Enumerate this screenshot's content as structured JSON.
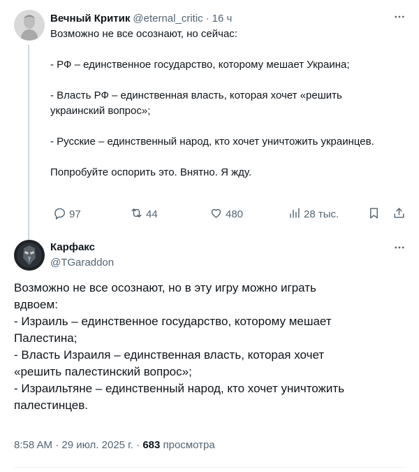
{
  "tweet1": {
    "display_name": "Вечный Критик",
    "handle": "@eternal_critic",
    "separator": "·",
    "time": "16 ч",
    "text": "Возможно не все осознают, но сейчас:\n\n- РФ – единственное государство, которому мешает Украина;\n\n- Власть РФ – единственная власть, которая хочет «решить украинский вопрос»;\n\n- Русские – единственный народ, кто хочет уничтожить украинцев.\n\nПопробуйте оспорить это. Внятно. Я жду.",
    "replies": "97",
    "retweets": "44",
    "likes": "480",
    "views": "28 тыс."
  },
  "tweet2": {
    "display_name": "Карфакс",
    "handle": "@TGaraddon",
    "text_lines": [
      "Возможно не все осознают, но в эту игру можно играть",
      "вдвоем:",
      "- Израиль – единственное государство, которому мешает",
      "Палестина;",
      "- Власть Израиля – единственная власть, которая хочет",
      "«решить палестинский вопрос»;",
      "- Израильтяне – единственный народ, кто хочет уничтожить",
      "палестинцев."
    ],
    "time": "8:58 AM",
    "separator": "·",
    "date": "29 июл. 2025 г.",
    "views_count": "683",
    "views_label": "просмотра"
  },
  "colors": {
    "text": "#0f1419",
    "secondary": "#536471",
    "thread_line": "#cfd9de"
  },
  "icons": [
    "more-icon",
    "reply-icon",
    "retweet-icon",
    "like-icon",
    "views-icon",
    "bookmark-icon",
    "share-icon"
  ]
}
